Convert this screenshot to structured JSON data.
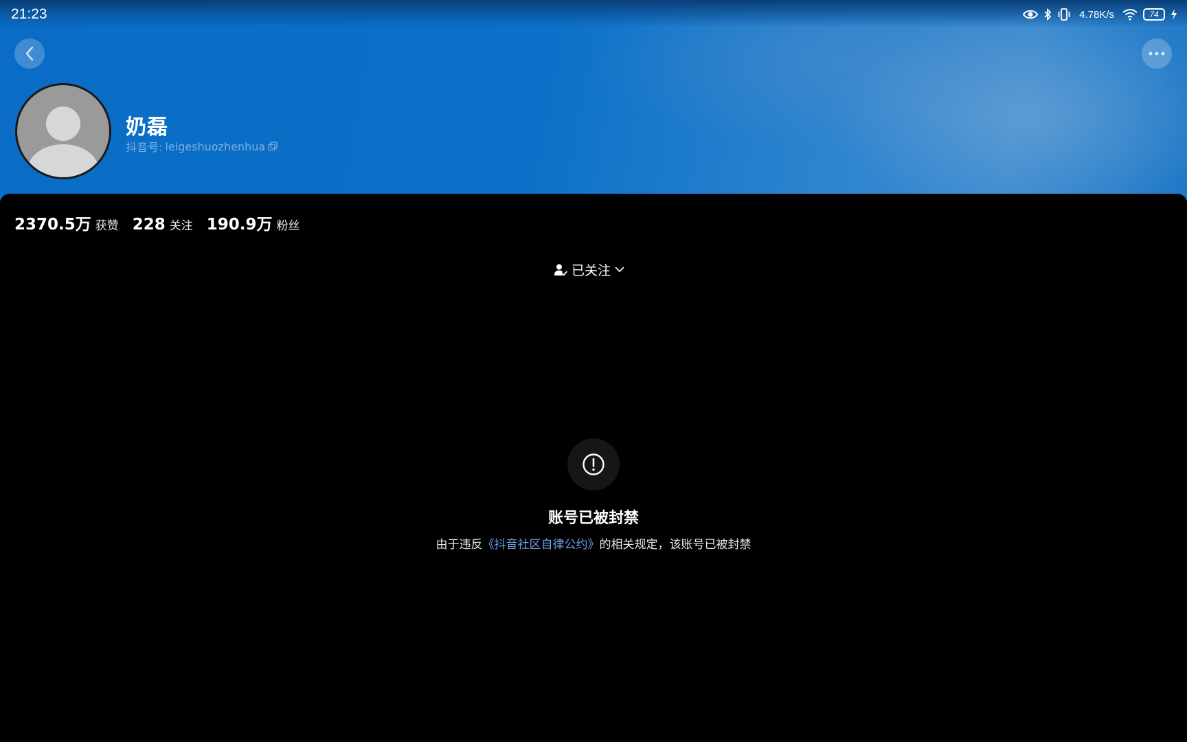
{
  "status_bar": {
    "time": "21:23",
    "net_speed": "4.78K/s",
    "battery": "74",
    "icons": [
      "eye-icon",
      "bluetooth-icon",
      "vibrate-icon",
      "wifi-icon",
      "battery-icon",
      "charging-icon"
    ]
  },
  "header": {
    "back_icon": "chevron-left-icon",
    "more_icon": "more-horizontal-icon",
    "accent_color": "#0b6fc8"
  },
  "profile": {
    "name": "奶磊",
    "douyin_id_label": "抖音号:",
    "douyin_id": "leigeshuozhenhua",
    "copy_icon": "copy-icon"
  },
  "stats": [
    {
      "value": "2370.5万",
      "label": "获赞"
    },
    {
      "value": "228",
      "label": "关注"
    },
    {
      "value": "190.9万",
      "label": "粉丝"
    }
  ],
  "follow": {
    "label": "已关注",
    "icon": "user-check-icon",
    "dropdown_icon": "chevron-down-icon"
  },
  "banned": {
    "icon": "alert-circle-icon",
    "title": "账号已被封禁",
    "desc_before": "由于违反",
    "link_text": "《抖音社区自律公约》",
    "desc_after": "的相关规定，该账号已被封禁",
    "link_color": "#6b9fe6"
  }
}
